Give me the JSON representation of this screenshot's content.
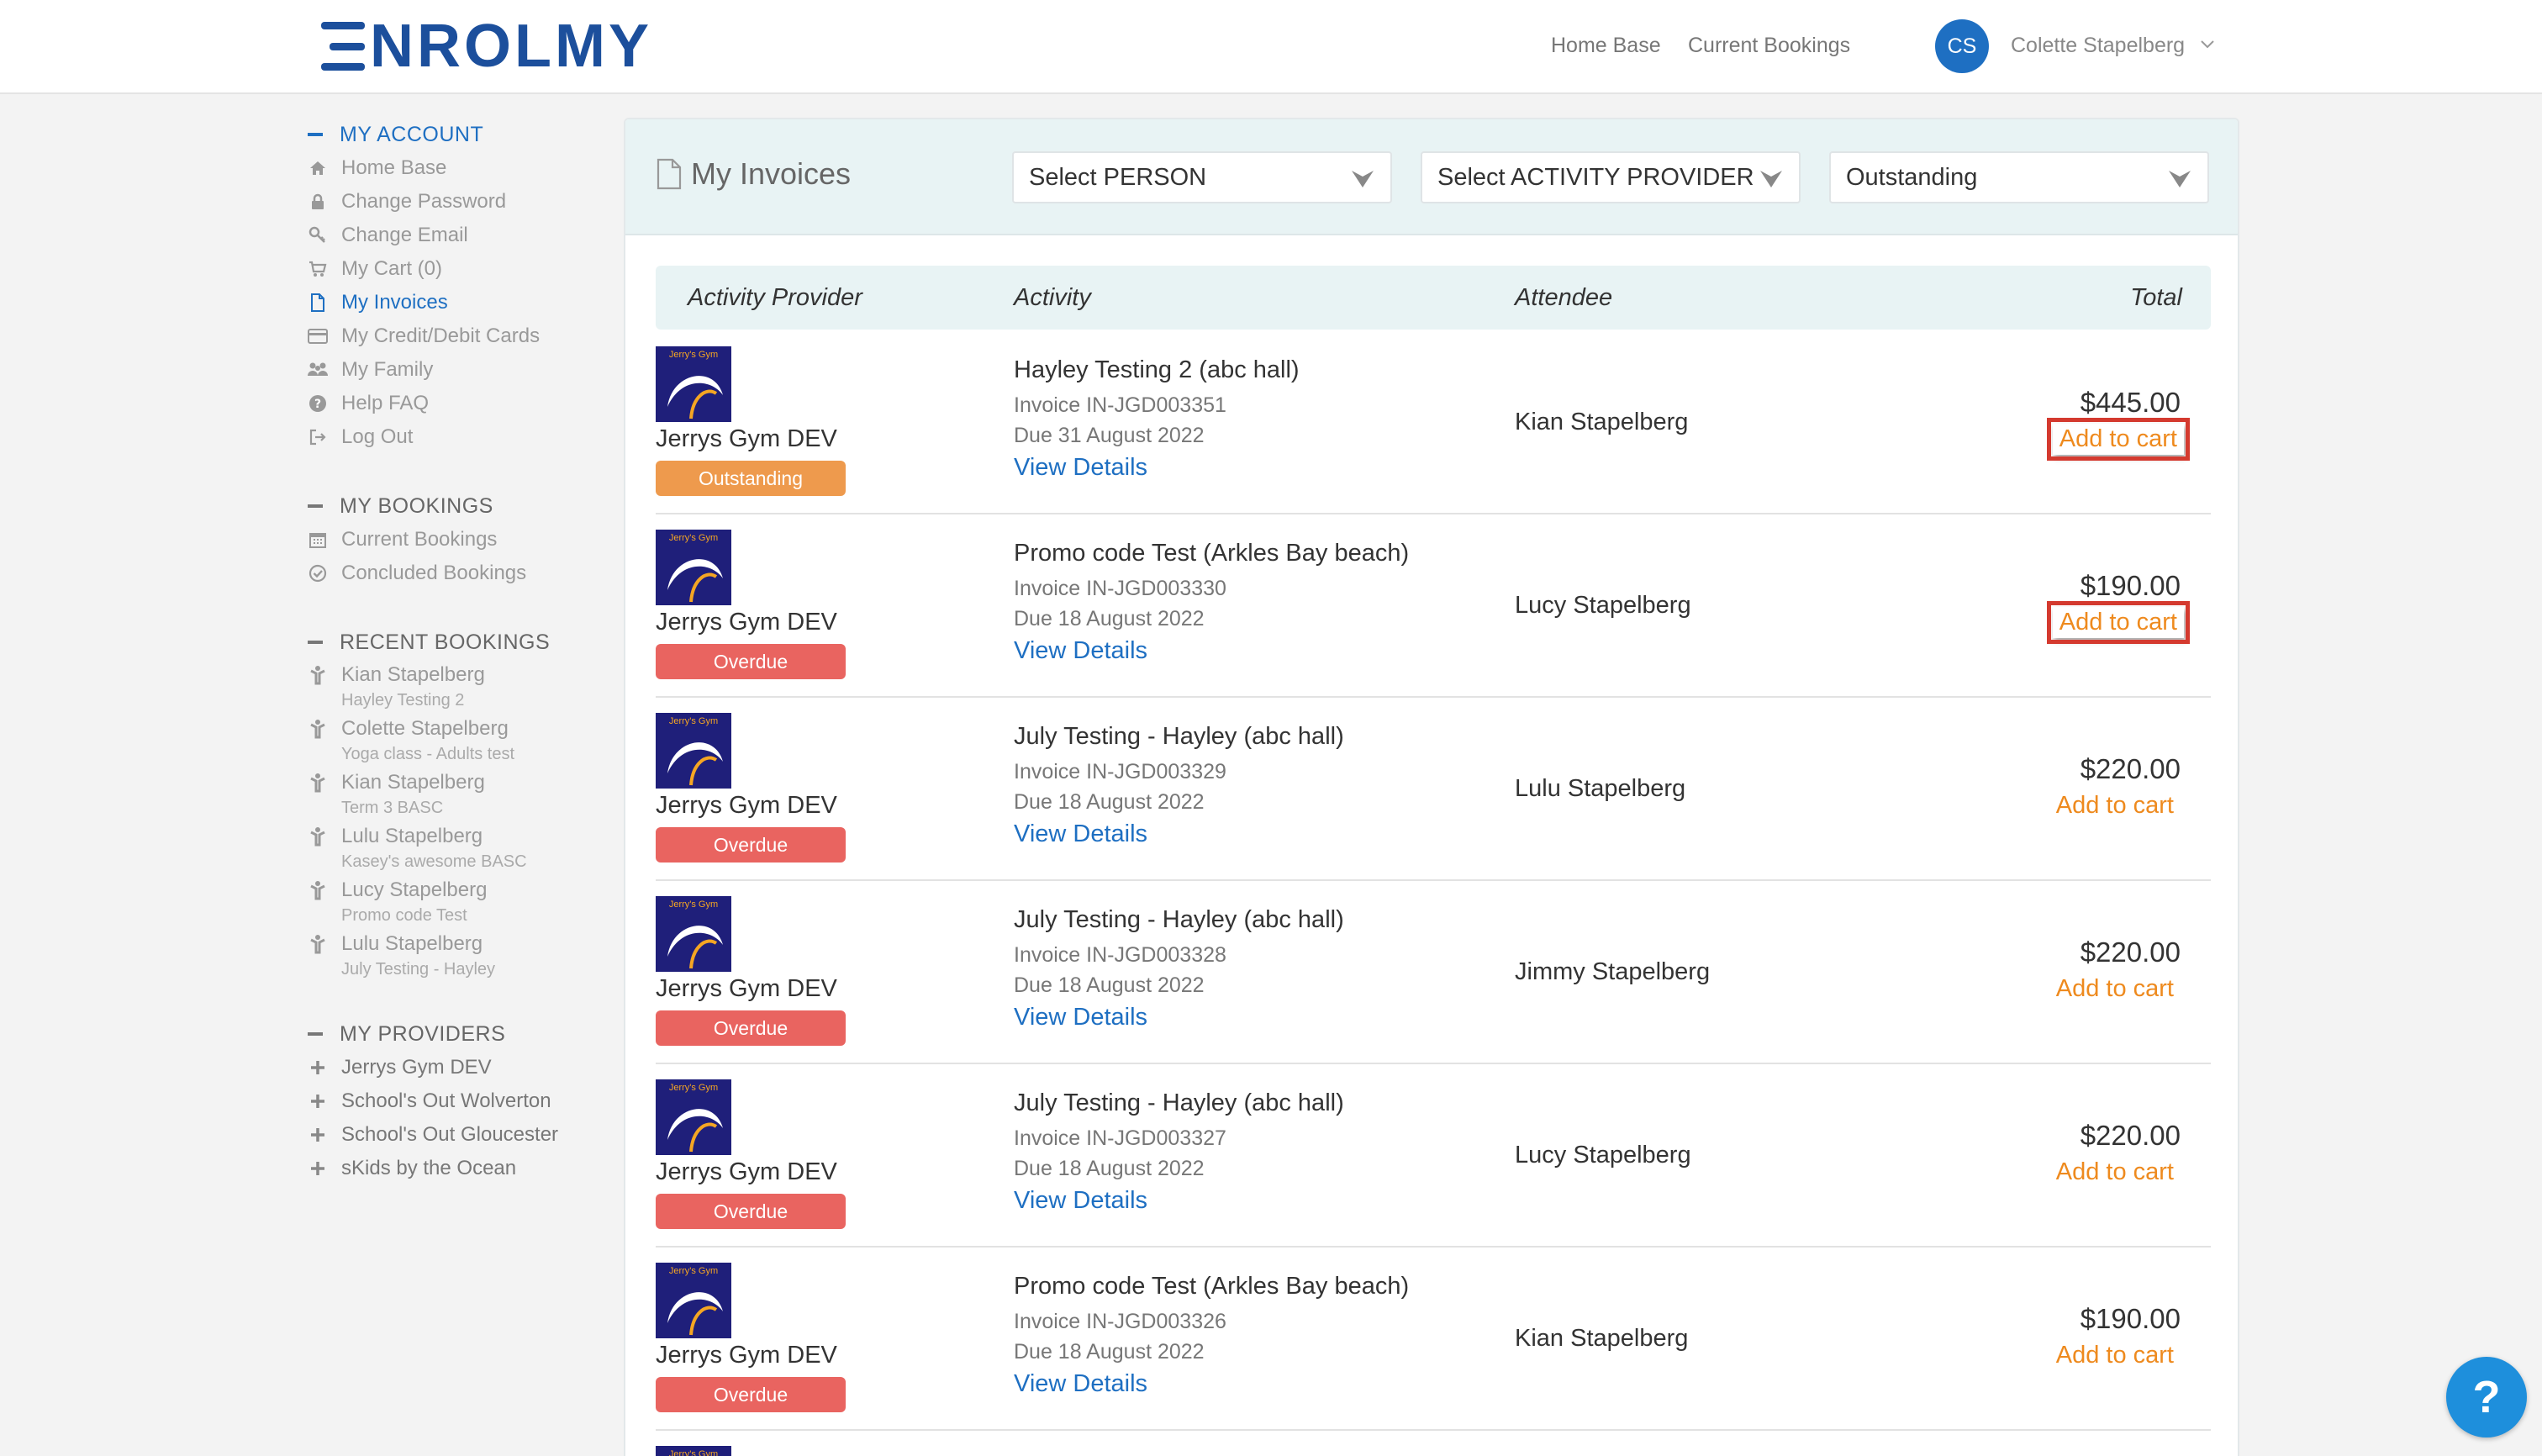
{
  "header": {
    "logo": "NROLMY",
    "nav": [
      "Home Base",
      "Current Bookings"
    ],
    "user_initials": "CS",
    "user_name": "Colette Stapelberg"
  },
  "sidebar": {
    "my_account": {
      "title": "MY ACCOUNT",
      "items": [
        {
          "label": "Home Base",
          "icon": "home-icon"
        },
        {
          "label": "Change Password",
          "icon": "lock-icon"
        },
        {
          "label": "Change Email",
          "icon": "key-icon"
        },
        {
          "label": "My Cart (0)",
          "icon": "cart-icon"
        },
        {
          "label": "My Invoices",
          "icon": "document-icon"
        },
        {
          "label": "My Credit/Debit Cards",
          "icon": "credit-card-icon"
        },
        {
          "label": "My Family",
          "icon": "family-icon"
        },
        {
          "label": "Help FAQ",
          "icon": "question-icon"
        },
        {
          "label": "Log Out",
          "icon": "logout-icon"
        }
      ]
    },
    "my_bookings": {
      "title": "MY BOOKINGS",
      "items": [
        {
          "label": "Current Bookings",
          "icon": "calendar-icon"
        },
        {
          "label": "Concluded Bookings",
          "icon": "check-circle-icon"
        }
      ]
    },
    "recent_bookings": {
      "title": "RECENT BOOKINGS",
      "items": [
        {
          "name": "Kian Stapelberg",
          "activity": "Hayley Testing 2"
        },
        {
          "name": "Colette Stapelberg",
          "activity": "Yoga class - Adults test"
        },
        {
          "name": "Kian Stapelberg",
          "activity": "Term 3 BASC"
        },
        {
          "name": "Lulu Stapelberg",
          "activity": "Kasey's awesome BASC"
        },
        {
          "name": "Lucy Stapelberg",
          "activity": "Promo code Test"
        },
        {
          "name": "Lulu Stapelberg",
          "activity": "July Testing - Hayley"
        }
      ]
    },
    "my_providers": {
      "title": "MY PROVIDERS",
      "items": [
        "Jerrys Gym DEV",
        "School's Out Wolverton",
        "School's Out Gloucester",
        "sKids by the Ocean"
      ]
    }
  },
  "main": {
    "title": "My Invoices",
    "filters": {
      "person": "Select PERSON",
      "provider": "Select ACTIVITY PROVIDER",
      "status": "Outstanding"
    },
    "columns": [
      "Activity Provider",
      "Activity",
      "Attendee",
      "Total"
    ],
    "logo_text": "Jerry's Gym",
    "rows": [
      {
        "provider": "Jerrys Gym DEV",
        "status": "Outstanding",
        "activity": "Hayley Testing 2 (abc hall)",
        "invoice": "Invoice IN-JGD003351",
        "due": "Due 31 August 2022",
        "link": "View Details",
        "attendee": "Kian Stapelberg",
        "total": "$445.00",
        "cart": "Add to cart"
      },
      {
        "provider": "Jerrys Gym DEV",
        "status": "Overdue",
        "activity": "Promo code Test (Arkles Bay beach)",
        "invoice": "Invoice IN-JGD003330",
        "due": "Due 18 August 2022",
        "link": "View Details",
        "attendee": "Lucy Stapelberg",
        "total": "$190.00",
        "cart": "Add to cart"
      },
      {
        "provider": "Jerrys Gym DEV",
        "status": "Overdue",
        "activity": "July Testing - Hayley (abc hall)",
        "invoice": "Invoice IN-JGD003329",
        "due": "Due 18 August 2022",
        "link": "View Details",
        "attendee": "Lulu Stapelberg",
        "total": "$220.00",
        "cart": "Add to cart"
      },
      {
        "provider": "Jerrys Gym DEV",
        "status": "Overdue",
        "activity": "July Testing - Hayley (abc hall)",
        "invoice": "Invoice IN-JGD003328",
        "due": "Due 18 August 2022",
        "link": "View Details",
        "attendee": "Jimmy Stapelberg",
        "total": "$220.00",
        "cart": "Add to cart"
      },
      {
        "provider": "Jerrys Gym DEV",
        "status": "Overdue",
        "activity": "July Testing - Hayley (abc hall)",
        "invoice": "Invoice IN-JGD003327",
        "due": "Due 18 August 2022",
        "link": "View Details",
        "attendee": "Lucy Stapelberg",
        "total": "$220.00",
        "cart": "Add to cart"
      },
      {
        "provider": "Jerrys Gym DEV",
        "status": "Overdue",
        "activity": "Promo code Test (Arkles Bay beach)",
        "invoice": "Invoice IN-JGD003326",
        "due": "Due 18 August 2022",
        "link": "View Details",
        "attendee": "Kian Stapelberg",
        "total": "$190.00",
        "cart": "Add to cart"
      }
    ]
  },
  "help_button": "?",
  "colors": {
    "brand": "#1c4f9c",
    "link": "#1e6fc2",
    "outstanding": "#ee9a4d",
    "overdue": "#e96460",
    "cart": "#ee8a1e",
    "highlight": "#d43a2f"
  }
}
